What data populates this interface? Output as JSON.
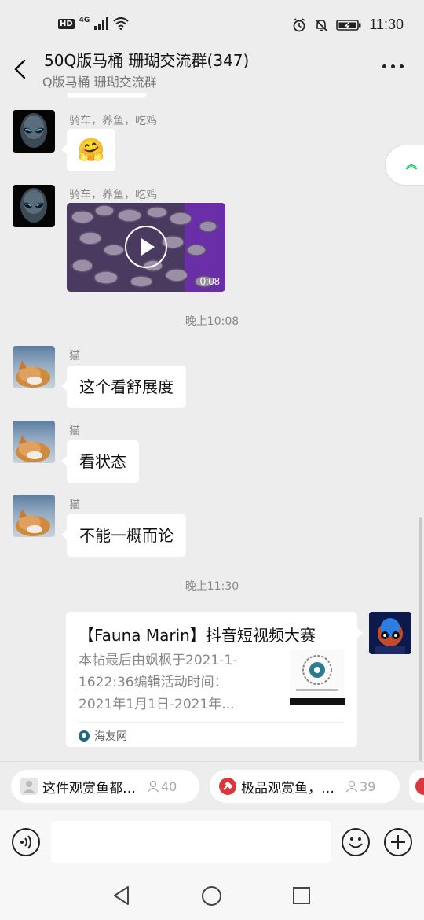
{
  "status_bar": {
    "hd": "HD",
    "network": "4G",
    "time": "11:30"
  },
  "header": {
    "title": "50Q版马桶 珊瑚交流群(347)",
    "subtitle": "Q版马桶 珊瑚交流群"
  },
  "messages": {
    "m1": {
      "sender": "骑车，养鱼，吃鸡",
      "content": "🤗"
    },
    "m2": {
      "sender": "骑车，养鱼，吃鸡",
      "video_duration": "0:08"
    },
    "time1": "晚上10:08",
    "m3": {
      "sender": "猫",
      "text": "这个看舒展度"
    },
    "m4": {
      "sender": "猫",
      "text": "看状态"
    },
    "m5": {
      "sender": "猫",
      "text": "不能一概而论"
    },
    "time2": "晚上11:30",
    "m6": {
      "title": "【Fauna Marin】抖音短视频大赛",
      "description": "本帖最后由飒枫于2021-1-1622:36编辑活动时间：2021年1月1日-2021年...",
      "source": "海友网"
    }
  },
  "suggestions": [
    {
      "label": "这件观赏鱼都…",
      "count": "40",
      "icon": "person-icon"
    },
    {
      "label": "极品观赏鱼，…",
      "count": "39",
      "icon": "hammer-icon"
    }
  ],
  "colors": {
    "background": "#ededed",
    "bubble": "#ffffff",
    "accent_green": "#07c160",
    "chip_red": "#d9363e"
  }
}
